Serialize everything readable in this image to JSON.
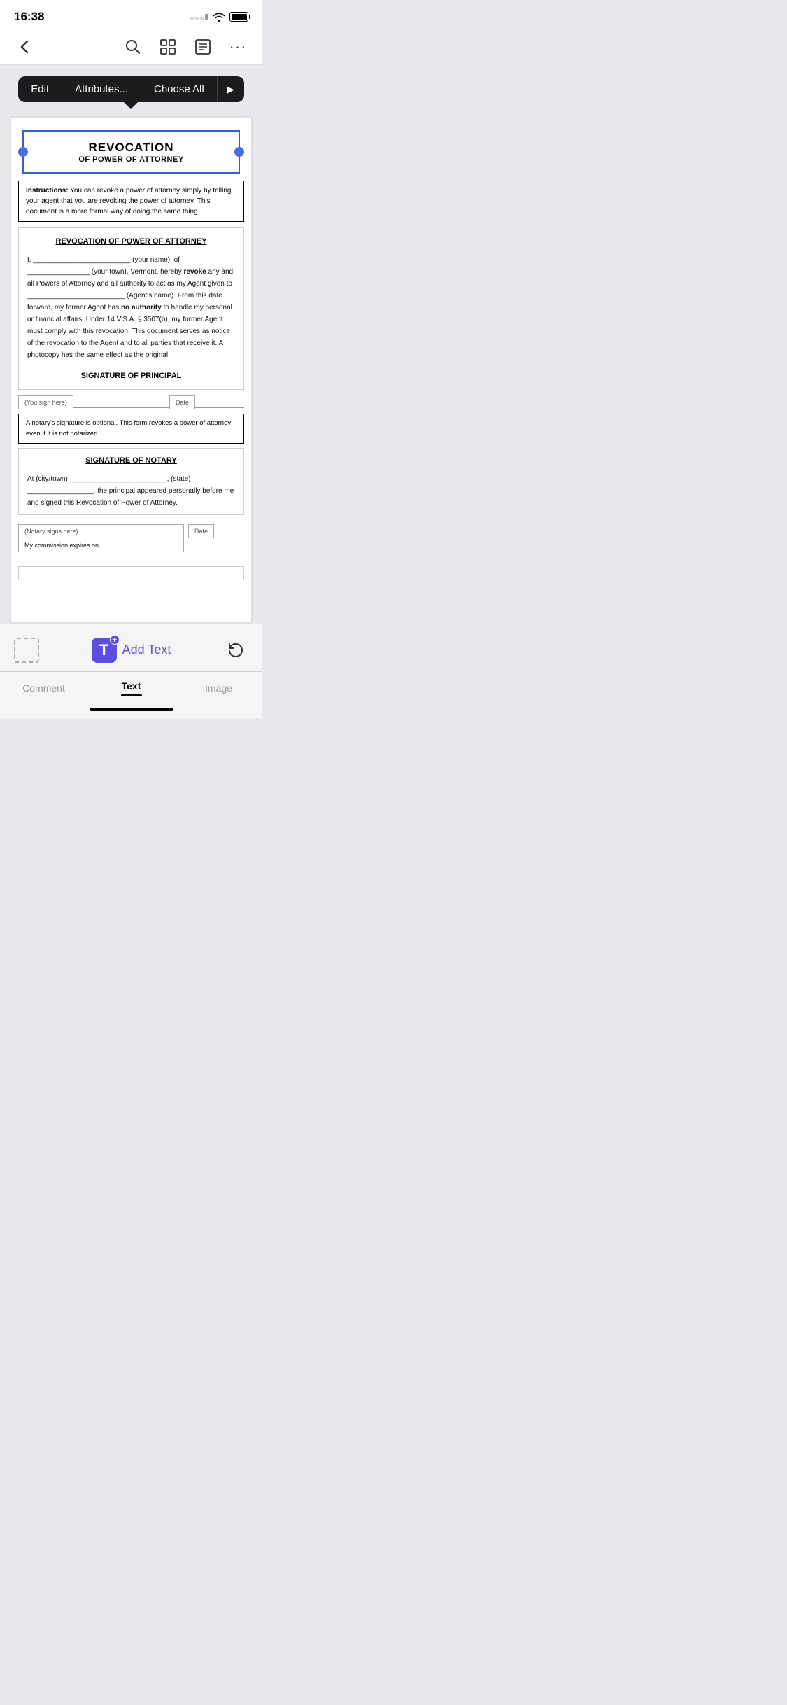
{
  "statusBar": {
    "time": "16:38"
  },
  "toolbar": {
    "backLabel": "‹",
    "searchIcon": "search",
    "gridIcon": "grid",
    "listIcon": "list",
    "moreIcon": "more"
  },
  "contextMenu": {
    "editLabel": "Edit",
    "attributesLabel": "Attributes...",
    "chooseAllLabel": "Choose All",
    "playIcon": "▶"
  },
  "document": {
    "title": "REVOCATION",
    "subtitle": "OF POWER OF ATTORNEY",
    "instructionsLabel": "Instructions:",
    "instructionsText": " You can revoke a power of attorney simply by telling your agent that you are revoking the power of attorney.  This document is a more formal way of doing the same thing.",
    "sectionTitle": "REVOCATION OF POWER OF ATTORNEY",
    "bodyText1": "I, _________________________ (your name), of ________________ (your town), Vermont, hereby ",
    "bodyBold1": "revoke",
    "bodyText2": " any and all Powers of Attorney and all authority to act as my Agent given to _________________________ (Agent's name).  From this date forward, my former Agent has ",
    "bodyBold2": "no authority",
    "bodyText3": " to handle my personal or financial affairs.  Under 14 V.S.A. § 3507(b), my former Agent must comply with this revocation. This document serves as notice of the revocation to the Agent and to all parties that receive it.  A photocopy has the same effect as the original.",
    "signaturePrincipalLabel": "SIGNATURE OF PRINCIPAL",
    "signHereLabel": "(You sign here)",
    "dateLabel": "Date",
    "notaryNotice": "A notary's signature is optional.  This form revokes a power of attorney even if it is not notarized.",
    "signatureNotaryLabel": "SIGNATURE OF NOTARY",
    "notaryText": "At (city/town) _________________________, (state) _________________, the principal appeared personally before me and signed this Revocation of Power of Attorney.",
    "notarySignLabel": "(Notary signs here)",
    "notaryDateLabel": "Date",
    "commissionText": "My commission expires on "
  },
  "bottomBar": {
    "addTextLabel": "Add Text",
    "addTextIconText": "T",
    "tabs": [
      {
        "label": "Comment",
        "active": false
      },
      {
        "label": "Text",
        "active": true
      },
      {
        "label": "Image",
        "active": false
      }
    ]
  }
}
